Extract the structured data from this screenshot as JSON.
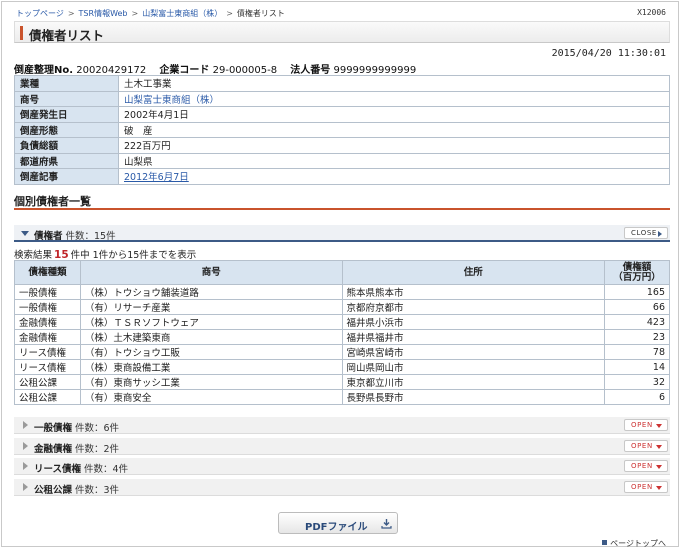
{
  "breadcrumbs": [
    {
      "label": "トップページ",
      "link": true
    },
    {
      "label": "TSR情報Web",
      "link": true
    },
    {
      "label": "山梨富士東商組（株）",
      "link": true
    },
    {
      "label": "債権者リスト",
      "link": false
    }
  ],
  "screen_id": "X12006",
  "page_title": "債権者リスト",
  "timestamp": "2015/04/20 11:30:01",
  "meta": {
    "case_label": "倒産整理No.",
    "case_value": "20020429172",
    "company_code_label": "企業コード",
    "company_code_value": "29-000005-8",
    "corp_number_label": "法人番号",
    "corp_number_value": "9999999999999"
  },
  "info_rows": [
    {
      "key": "業種",
      "value": "土木工事業",
      "style": "plain"
    },
    {
      "key": "商号",
      "value": "山梨富士東商組（株）",
      "style": "link"
    },
    {
      "key": "倒産発生日",
      "value": "2002年4月1日",
      "style": "plain"
    },
    {
      "key": "倒産形態",
      "value": "破　産",
      "style": "plain"
    },
    {
      "key": "負債総額",
      "value": "222百万円",
      "style": "plain"
    },
    {
      "key": "都道府県",
      "value": "山梨県",
      "style": "plain"
    },
    {
      "key": "倒産記事",
      "value": "2012年6月7日",
      "style": "underline"
    }
  ],
  "section_title": "個別債権者一覧",
  "main_accordion": {
    "title": "債権者",
    "count": "件数：15件",
    "button": "CLOSE"
  },
  "results": {
    "prefix": "検索結果",
    "total": "15",
    "suffix": "件中 1件から15件までを表示"
  },
  "table": {
    "headers": {
      "type": "債権種類",
      "name": "商号",
      "address": "住所",
      "amount_line1": "債権額",
      "amount_line2": "（百万円）"
    },
    "rows": [
      {
        "type": "一般債権",
        "name": "（株）トウショウ舗装道路",
        "address": "熊本県熊本市",
        "amount": "165"
      },
      {
        "type": "一般債権",
        "name": "（有）リサーチ産業",
        "address": "京都府京都市",
        "amount": "66"
      },
      {
        "type": "金融債権",
        "name": "（株）ＴＳＲソフトウェア",
        "address": "福井県小浜市",
        "amount": "423"
      },
      {
        "type": "金融債権",
        "name": "（株）土木建築東商",
        "address": "福井県福井市",
        "amount": "23"
      },
      {
        "type": "リース債権",
        "name": "（有）トウショウ工販",
        "address": "宮崎県宮崎市",
        "amount": "78"
      },
      {
        "type": "リース債権",
        "name": "（株）東商設備工業",
        "address": "岡山県岡山市",
        "amount": "14"
      },
      {
        "type": "公租公課",
        "name": "（有）東商サッシ工業",
        "address": "東京都立川市",
        "amount": "32"
      },
      {
        "type": "公租公課",
        "name": "（有）東商安全",
        "address": "長野県長野市",
        "amount": "6"
      }
    ]
  },
  "sub_accordions": [
    {
      "title": "一般債権",
      "count": "件数：6件",
      "button": "OPEN"
    },
    {
      "title": "金融債権",
      "count": "件数：2件",
      "button": "OPEN"
    },
    {
      "title": "リース債権",
      "count": "件数：4件",
      "button": "OPEN"
    },
    {
      "title": "公租公課",
      "count": "件数：3件",
      "button": "OPEN"
    }
  ],
  "pdf_button": "PDFファイル",
  "page_top": "ページトップへ",
  "colors": {
    "accent": "#c9532c",
    "link": "#2a5aa8",
    "header_bg": "#d8e4f0",
    "highlight": "#c0262a"
  },
  "icons": {
    "collapse": "chevron-down-icon",
    "expand": "chevron-right-icon",
    "download": "download-icon"
  }
}
